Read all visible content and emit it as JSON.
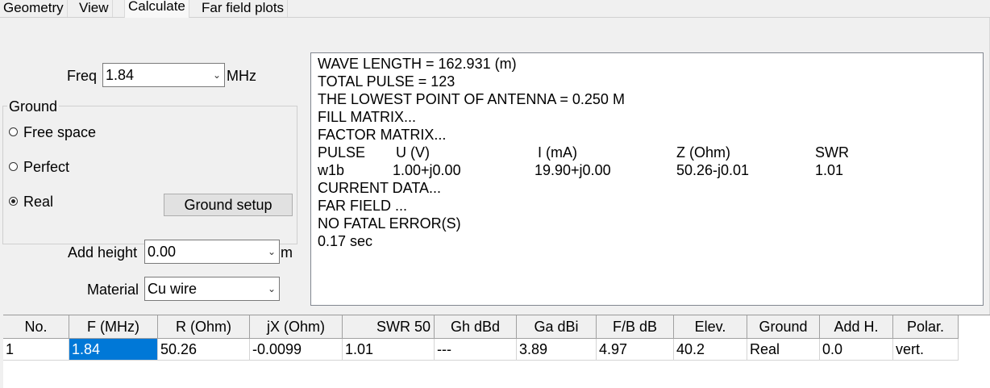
{
  "tabs": [
    {
      "label": "Geometry"
    },
    {
      "label": "View"
    },
    {
      "label": "Calculate"
    },
    {
      "label": "Far field plots"
    }
  ],
  "calc": {
    "freq_label": "Freq",
    "freq_value": "1.84",
    "freq_unit": "MHz",
    "ground_title": "Ground",
    "ground_options": [
      "Free space",
      "Perfect",
      "Real"
    ],
    "ground_selected": "Real",
    "ground_setup_label": "Ground setup",
    "add_height_label": "Add height",
    "add_height_value": "0.00",
    "add_height_unit": "m",
    "material_label": "Material",
    "material_value": "Cu wire"
  },
  "output": {
    "lines": [
      "WAVE LENGTH = 162.931 (m)",
      "TOTAL PULSE = 123",
      "THE LOWEST POINT OF ANTENNA = 0.250 M",
      "FILL MATRIX...",
      "FACTOR MATRIX..."
    ],
    "pulse_header": [
      "PULSE",
      "U (V)",
      "I (mA)",
      "Z (Ohm)",
      "SWR"
    ],
    "pulse_row": [
      "w1b",
      "1.00+j0.00",
      "19.90+j0.00",
      "50.26-j0.01",
      "1.01"
    ],
    "tail_lines": [
      "CURRENT DATA...",
      "FAR FIELD ...",
      "NO FATAL ERROR(S)",
      "0.17 sec"
    ]
  },
  "results_table": {
    "columns": [
      "No.",
      "F (MHz)",
      "R (Ohm)",
      "jX (Ohm)",
      "SWR 50",
      "Gh dBd",
      "Ga dBi",
      "F/B dB",
      "Elev.",
      "Ground",
      "Add H.",
      "Polar."
    ],
    "rows": [
      [
        "1",
        "1.84",
        "50.26",
        "-0.0099",
        "1.01",
        "---",
        "3.89",
        "4.97",
        "40.2",
        "Real",
        "0.0",
        "vert."
      ]
    ]
  },
  "colors": {
    "selection": "#0078d7",
    "panel_bg": "#f0f0f0"
  }
}
